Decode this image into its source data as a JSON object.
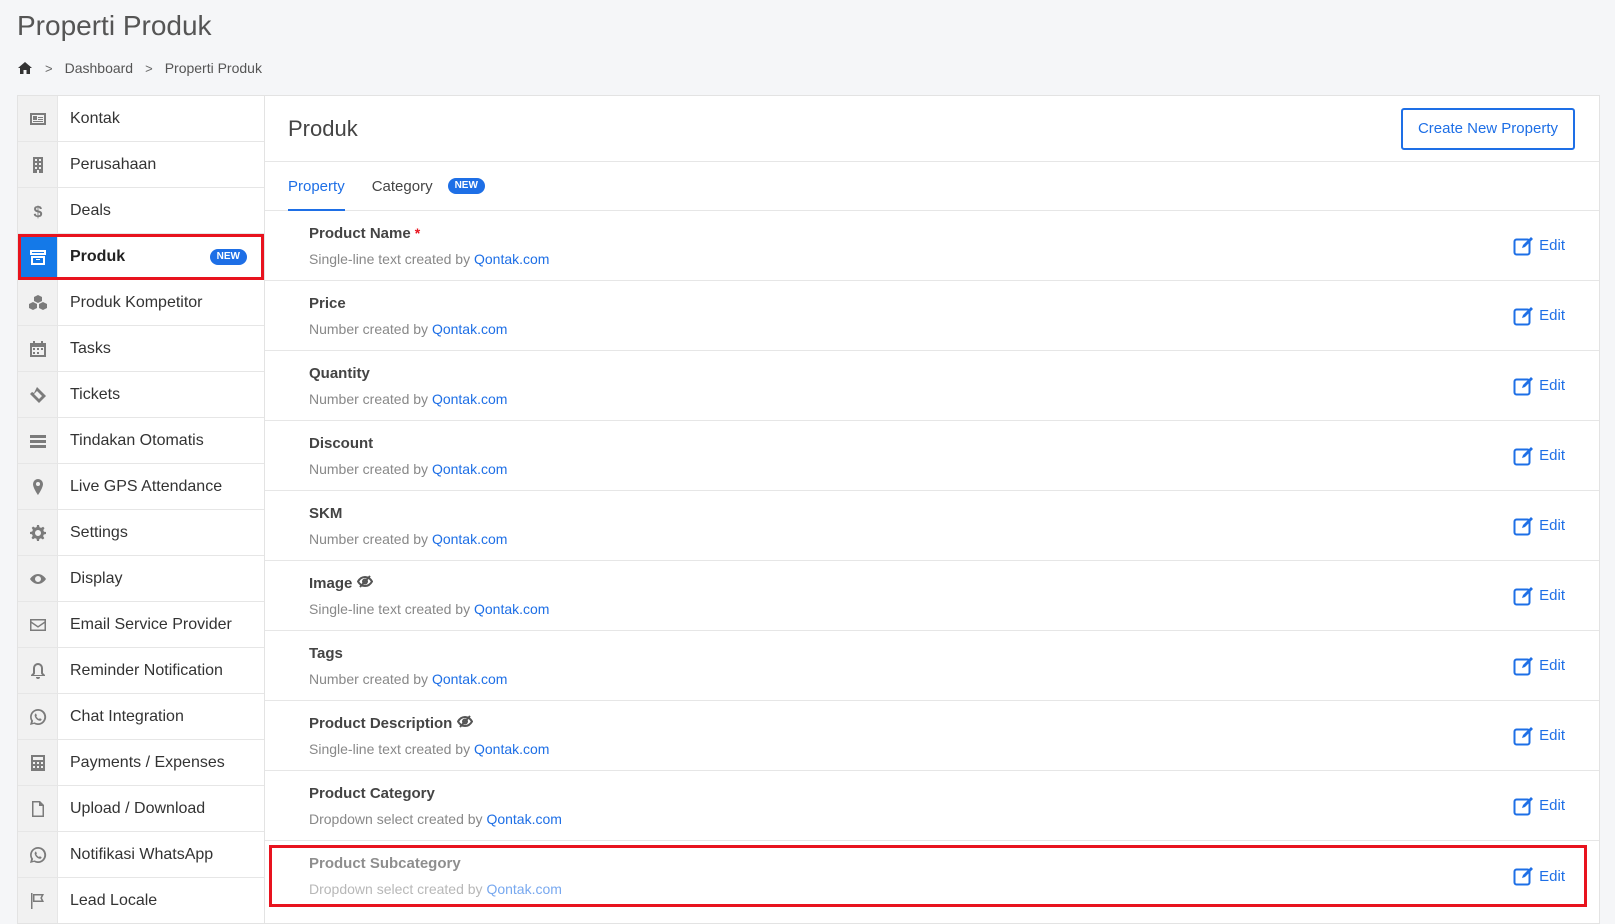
{
  "page": {
    "title": "Properti Produk"
  },
  "breadcrumb": {
    "home_icon": "home-icon",
    "items": [
      "Dashboard",
      "Properti Produk"
    ]
  },
  "sidebar": {
    "items": [
      {
        "label": "Kontak",
        "icon": "contact-card-icon"
      },
      {
        "label": "Perusahaan",
        "icon": "building-icon"
      },
      {
        "label": "Deals",
        "icon": "dollar-icon"
      },
      {
        "label": "Produk",
        "icon": "archive-box-icon",
        "active": true,
        "badge": "NEW"
      },
      {
        "label": "Produk Kompetitor",
        "icon": "cubes-icon"
      },
      {
        "label": "Tasks",
        "icon": "calendar-icon"
      },
      {
        "label": "Tickets",
        "icon": "ticket-icon"
      },
      {
        "label": "Tindakan Otomatis",
        "icon": "list-icon"
      },
      {
        "label": "Live GPS Attendance",
        "icon": "map-pin-icon"
      },
      {
        "label": "Settings",
        "icon": "gear-icon"
      },
      {
        "label": "Display",
        "icon": "eye-icon"
      },
      {
        "label": "Email Service Provider",
        "icon": "envelope-icon"
      },
      {
        "label": "Reminder Notification",
        "icon": "bell-icon"
      },
      {
        "label": "Chat Integration",
        "icon": "whatsapp-icon"
      },
      {
        "label": "Payments / Expenses",
        "icon": "calculator-icon"
      },
      {
        "label": "Upload / Download",
        "icon": "file-icon"
      },
      {
        "label": "Notifikasi WhatsApp",
        "icon": "whatsapp-icon"
      },
      {
        "label": "Lead Locale",
        "icon": "flag-icon"
      }
    ]
  },
  "main": {
    "title": "Produk",
    "create_button": "Create New Property",
    "tabs": [
      {
        "label": "Property",
        "active": true
      },
      {
        "label": "Category",
        "badge": "NEW"
      }
    ],
    "edit_label": "Edit",
    "link_text": "Qontak.com",
    "properties": [
      {
        "name": "Product Name",
        "required": "*",
        "desc": "Single-line text created by"
      },
      {
        "name": "Price",
        "desc": "Number created by"
      },
      {
        "name": "Quantity",
        "desc": "Number created by"
      },
      {
        "name": "Discount",
        "desc": "Number created by"
      },
      {
        "name": "SKM",
        "desc": "Number created by"
      },
      {
        "name": "Image",
        "hidden_icon": true,
        "desc": "Single-line text created by"
      },
      {
        "name": "Tags",
        "desc": "Number created by"
      },
      {
        "name": "Product Description",
        "hidden_icon": true,
        "desc": "Single-line text created by"
      },
      {
        "name": "Product Category",
        "desc": "Dropdown select created by"
      },
      {
        "name": "Product Subcategory",
        "desc": "Dropdown select created by",
        "highlighted": true
      }
    ]
  },
  "colors": {
    "accent": "#1e6fe6",
    "highlight": "#e8131e",
    "active_icon_bg": "#1479e8"
  }
}
